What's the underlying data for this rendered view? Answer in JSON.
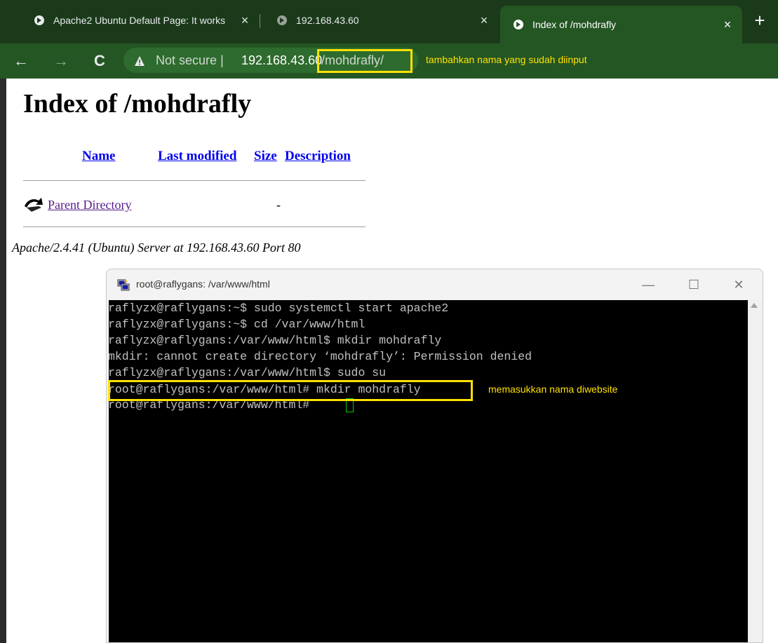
{
  "browser": {
    "tabs": [
      {
        "title": "Apache2 Ubuntu Default Page: It works",
        "close": "×"
      },
      {
        "title": "192.168.43.60",
        "close": "×"
      },
      {
        "title": "Index of /mohdrafly",
        "close": "×"
      }
    ],
    "new_tab": "+",
    "nav": {
      "back": "←",
      "forward": "→",
      "reload": "C"
    },
    "security_label": "Not secure",
    "separator": "|",
    "url_host": "192.168.43.60",
    "url_path": "/mohdrafly/",
    "annotation": "tambahkan nama yang sudah diinput",
    "theme_color": "#245624",
    "highlight_color": "#ffe100"
  },
  "page": {
    "title": "Index of /mohdrafly",
    "columns": [
      "Name",
      "Last modified",
      "Size",
      "Description"
    ],
    "rows": [
      {
        "name": "Parent Directory",
        "last_modified": "",
        "size": "-",
        "description": ""
      }
    ],
    "address": "Apache/2.4.41 (Ubuntu) Server at 192.168.43.60 Port 80"
  },
  "terminal": {
    "title": "root@raflygans: /var/www/html",
    "controls": {
      "minimize": "—",
      "maximize": "☐",
      "close": "✕"
    },
    "lines": [
      "raflyzx@raflygans:~$ sudo systemctl start apache2",
      "raflyzx@raflygans:~$ cd /var/www/html",
      "raflyzx@raflygans:/var/www/html$ mkdir mohdrafly",
      "mkdir: cannot create directory ‘mohdrafly’: Permission denied",
      "raflyzx@raflygans:/var/www/html$ sudo su",
      "root@raflygans:/var/www/html# mkdir mohdrafly",
      "root@raflygans:/var/www/html# "
    ],
    "annotation": "memasukkan nama diwebsite"
  }
}
